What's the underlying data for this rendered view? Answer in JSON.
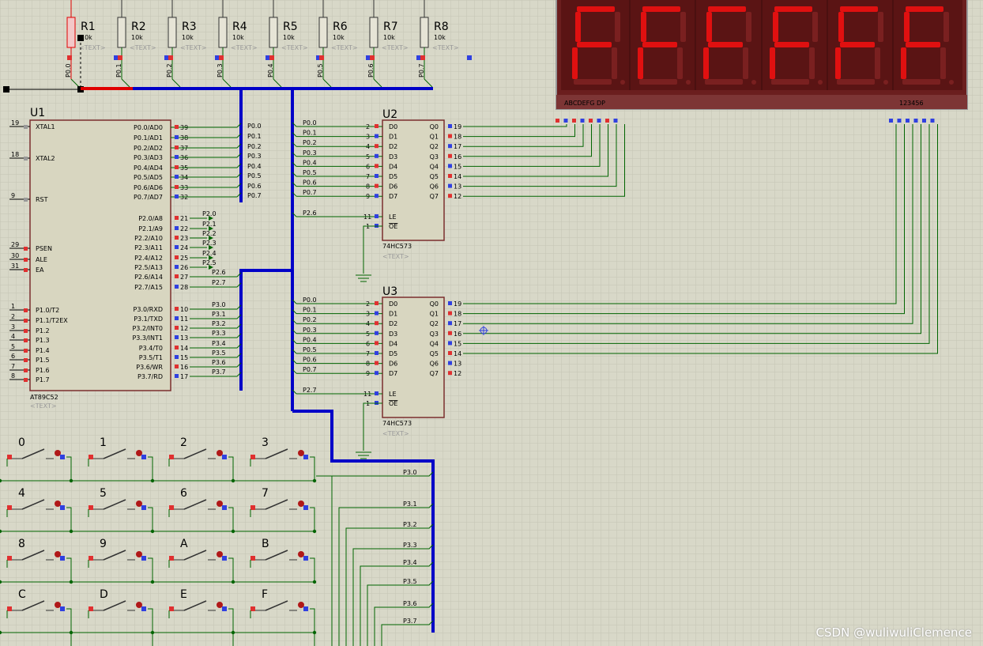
{
  "colors": {
    "background": "#d8d8c8",
    "grid": "#c5c5b4",
    "wire": "#006400",
    "bus": "#0000c8",
    "chip_fill": "#d8d6c0",
    "chip_border": "#7a2e2e",
    "pin_red": "#e03030",
    "pin_blue": "#3040e0",
    "display_body": "#6b1e1e",
    "segment_on": "#e01010",
    "segment_off": "#7a2020",
    "selected": "#e00000"
  },
  "resistors": [
    {
      "ref": "R1",
      "value": "10k",
      "net": "P0.0",
      "text": "<TEXT>",
      "selected": true
    },
    {
      "ref": "R2",
      "value": "10k",
      "net": "P0.1",
      "text": "<TEXT>"
    },
    {
      "ref": "R3",
      "value": "10k",
      "net": "P0.2",
      "text": "<TEXT>"
    },
    {
      "ref": "R4",
      "value": "10k",
      "net": "P0.3",
      "text": "<TEXT>"
    },
    {
      "ref": "R5",
      "value": "10k",
      "net": "P0.4",
      "text": "<TEXT>"
    },
    {
      "ref": "R6",
      "value": "10k",
      "net": "P0.5",
      "text": "<TEXT>"
    },
    {
      "ref": "R7",
      "value": "10k",
      "net": "P0.6",
      "text": "<TEXT>"
    },
    {
      "ref": "R8",
      "value": "10k",
      "net": "P0.7",
      "text": "<TEXT>"
    }
  ],
  "display": {
    "digits": [
      "F",
      "F",
      "F",
      "F",
      "F",
      "F"
    ],
    "seg_label": "ABCDEFG  DP",
    "com_label": "123456"
  },
  "u1": {
    "ref": "U1",
    "part": "AT89C52",
    "text": "<TEXT>",
    "left_pins": [
      {
        "num": "19",
        "name": "XTAL1"
      },
      {
        "num": "18",
        "name": "XTAL2"
      },
      {
        "num": "9",
        "name": "RST"
      },
      {
        "num": "29",
        "name": "PSEN"
      },
      {
        "num": "30",
        "name": "ALE"
      },
      {
        "num": "31",
        "name": "EA"
      },
      {
        "num": "1",
        "name": "P1.0/T2"
      },
      {
        "num": "2",
        "name": "P1.1/T2EX"
      },
      {
        "num": "3",
        "name": "P1.2"
      },
      {
        "num": "4",
        "name": "P1.3"
      },
      {
        "num": "5",
        "name": "P1.4"
      },
      {
        "num": "6",
        "name": "P1.5"
      },
      {
        "num": "7",
        "name": "P1.6"
      },
      {
        "num": "8",
        "name": "P1.7"
      }
    ],
    "right_p0": [
      {
        "num": "39",
        "name": "P0.0/AD0",
        "net": "P0.0"
      },
      {
        "num": "38",
        "name": "P0.1/AD1",
        "net": "P0.1"
      },
      {
        "num": "37",
        "name": "P0.2/AD2",
        "net": "P0.2"
      },
      {
        "num": "36",
        "name": "P0.3/AD3",
        "net": "P0.3"
      },
      {
        "num": "35",
        "name": "P0.4/AD4",
        "net": "P0.4"
      },
      {
        "num": "34",
        "name": "P0.5/AD5",
        "net": "P0.5"
      },
      {
        "num": "33",
        "name": "P0.6/AD6",
        "net": "P0.6"
      },
      {
        "num": "32",
        "name": "P0.7/AD7",
        "net": "P0.7"
      }
    ],
    "right_p2": [
      {
        "num": "21",
        "name": "P2.0/A8",
        "net": "P2.0"
      },
      {
        "num": "22",
        "name": "P2.1/A9",
        "net": "P2.1"
      },
      {
        "num": "23",
        "name": "P2.2/A10",
        "net": "P2.2"
      },
      {
        "num": "24",
        "name": "P2.3/A11",
        "net": "P2.3"
      },
      {
        "num": "25",
        "name": "P2.4/A12",
        "net": "P2.4"
      },
      {
        "num": "26",
        "name": "P2.5/A13",
        "net": "P2.5"
      },
      {
        "num": "27",
        "name": "P2.6/A14",
        "net": "P2.6"
      },
      {
        "num": "28",
        "name": "P2.7/A15",
        "net": "P2.7"
      }
    ],
    "right_p3": [
      {
        "num": "10",
        "name": "P3.0/RXD",
        "net": "P3.0"
      },
      {
        "num": "11",
        "name": "P3.1/TXD",
        "net": "P3.1"
      },
      {
        "num": "12",
        "name": "P3.2/INT0",
        "net": "P3.2"
      },
      {
        "num": "13",
        "name": "P3.3/INT1",
        "net": "P3.3"
      },
      {
        "num": "14",
        "name": "P3.4/T0",
        "net": "P3.4"
      },
      {
        "num": "15",
        "name": "P3.5/T1",
        "net": "P3.5"
      },
      {
        "num": "16",
        "name": "P3.6/WR",
        "net": "P3.6"
      },
      {
        "num": "17",
        "name": "P3.7/RD",
        "net": "P3.7"
      }
    ]
  },
  "latches": [
    {
      "ref": "U2",
      "part": "74HC573",
      "text": "<TEXT>",
      "le_net": "P2.6",
      "d_nets": [
        "P0.0",
        "P0.1",
        "P0.2",
        "P0.3",
        "P0.4",
        "P0.5",
        "P0.6",
        "P0.7"
      ],
      "d_nums": [
        "2",
        "3",
        "4",
        "5",
        "6",
        "7",
        "8",
        "9"
      ],
      "q_nums": [
        "19",
        "18",
        "17",
        "16",
        "15",
        "14",
        "13",
        "12"
      ],
      "d_names": [
        "D0",
        "D1",
        "D2",
        "D3",
        "D4",
        "D5",
        "D6",
        "D7"
      ],
      "q_names": [
        "Q0",
        "Q1",
        "Q2",
        "Q3",
        "Q4",
        "Q5",
        "Q6",
        "Q7"
      ],
      "le": {
        "num": "11",
        "name": "LE"
      },
      "oe": {
        "num": "1",
        "name": "OE"
      }
    },
    {
      "ref": "U3",
      "part": "74HC573",
      "text": "<TEXT>",
      "le_net": "P2.7",
      "d_nets": [
        "P0.0",
        "P0.1",
        "P0.2",
        "P0.3",
        "P0.4",
        "P0.5",
        "P0.6",
        "P0.7"
      ],
      "d_nums": [
        "2",
        "3",
        "4",
        "5",
        "6",
        "7",
        "8",
        "9"
      ],
      "q_nums": [
        "19",
        "18",
        "17",
        "16",
        "15",
        "14",
        "13",
        "12"
      ],
      "d_names": [
        "D0",
        "D1",
        "D2",
        "D3",
        "D4",
        "D5",
        "D6",
        "D7"
      ],
      "q_names": [
        "Q0",
        "Q1",
        "Q2",
        "Q3",
        "Q4",
        "Q5",
        "Q6",
        "Q7"
      ],
      "le": {
        "num": "11",
        "name": "LE"
      },
      "oe": {
        "num": "1",
        "name": "OE"
      }
    }
  ],
  "keypad": {
    "keys": [
      "0",
      "1",
      "2",
      "3",
      "4",
      "5",
      "6",
      "7",
      "8",
      "9",
      "A",
      "B",
      "C",
      "D",
      "E",
      "F"
    ],
    "port_labels": [
      "P3.0",
      "P3.1",
      "P3.2",
      "P3.3",
      "P3.4",
      "P3.5",
      "P3.6",
      "P3.7"
    ]
  },
  "watermark": "CSDN @wuliwuliClemence"
}
